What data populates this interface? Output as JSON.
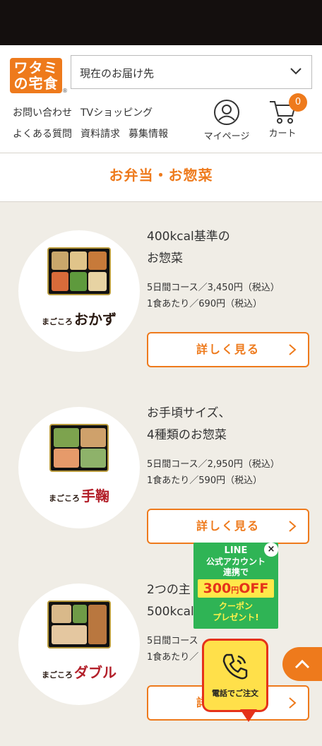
{
  "header": {
    "logo_line1": "ワタミ",
    "logo_line2": "の宅食",
    "logo_reg": "®",
    "address_label": "現在のお届け先",
    "links_row1": [
      "お問い合わせ",
      "TVショッピング"
    ],
    "links_row2": [
      "よくある質問",
      "資料請求",
      "募集情報"
    ],
    "mypage_label": "マイページ",
    "cart_label": "カート",
    "cart_count": "0"
  },
  "section_title": "お弁当・お惣菜",
  "items": [
    {
      "title_line1": "400kcal基準の",
      "title_line2": "お惣菜",
      "price_course": "5日間コース／3,450円（税込）",
      "price_meal": "1食あたり／690円（税込）",
      "brand_small": "まごころ",
      "brand_main": "おかず",
      "button_label": "詳しく見る"
    },
    {
      "title_line1": "お手頃サイズ、",
      "title_line2": "4種類のお惣菜",
      "price_course": "5日間コース／2,950円（税込）",
      "price_meal": "1食あたり／590円（税込）",
      "brand_small": "まごころ",
      "brand_main": "手鞠",
      "button_label": "詳しく見る"
    },
    {
      "title_line1": "2つの主",
      "title_line2": "500kcal",
      "price_course": "5日間コース",
      "price_meal": "1食あたり／",
      "brand_small": "まごころ",
      "brand_main": "ダブル",
      "button_label": "詳しく見る"
    }
  ],
  "line_banner": {
    "line1": "LINE",
    "line2": "公式アカウント",
    "line3": "連携で",
    "offer_amount": "300",
    "offer_unit": "円",
    "offer_off": "OFF",
    "line4": "クーポン",
    "line5": "プレゼント!",
    "close": "×"
  },
  "tel_label": "電話でご注文",
  "colors": {
    "accent": "#ee7a1c",
    "line_green": "#2fb455",
    "tel_yellow": "#ffe04a",
    "tel_red": "#e5321a"
  }
}
